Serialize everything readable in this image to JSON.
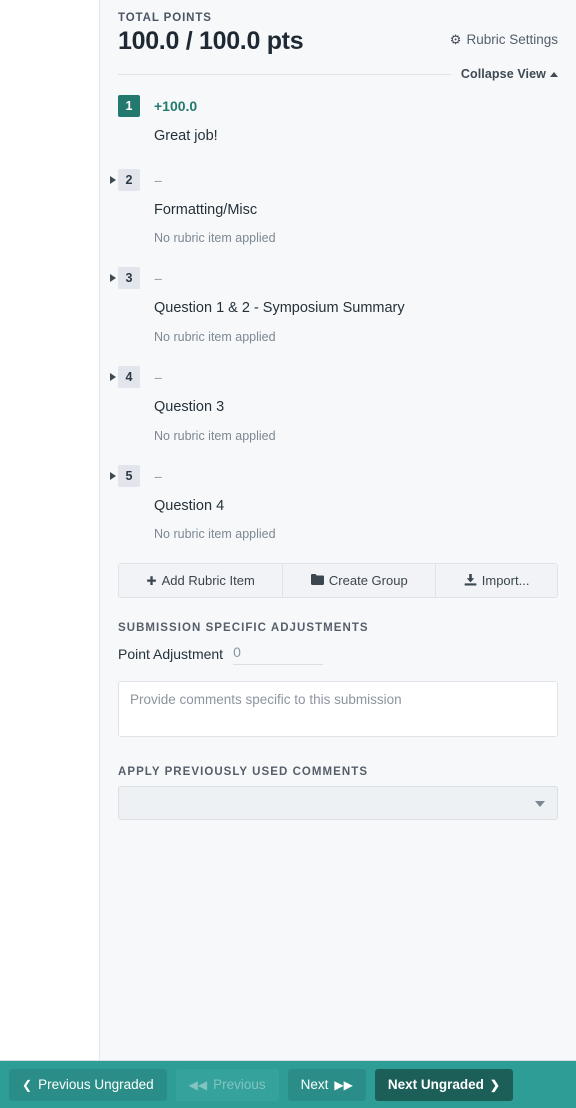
{
  "rubric": {
    "total_points_label": "TOTAL POINTS",
    "total_points_value": "100.0 / 100.0 pts",
    "settings_label": "Rubric Settings",
    "settings_icon": "gear-icon",
    "collapse_label": "Collapse View",
    "collapse_icon": "caret-up-icon",
    "items": [
      {
        "number": "1",
        "points": "+100.0",
        "description": "Great job!",
        "note": "",
        "applied": true,
        "expandable": false
      },
      {
        "number": "2",
        "points": "--",
        "description": "Formatting/Misc",
        "note": "No rubric item applied",
        "applied": false,
        "expandable": true
      },
      {
        "number": "3",
        "points": "--",
        "description": "Question 1 & 2 - Symposium Summary",
        "note": "No rubric item applied",
        "applied": false,
        "expandable": true
      },
      {
        "number": "4",
        "points": "--",
        "description": "Question 3",
        "note": "No rubric item applied",
        "applied": false,
        "expandable": true
      },
      {
        "number": "5",
        "points": "--",
        "description": "Question 4",
        "note": "No rubric item applied",
        "applied": false,
        "expandable": true
      }
    ],
    "actions": [
      {
        "label": "Add Rubric Item",
        "icon": "plus-icon",
        "glyph": "✚"
      },
      {
        "label": "Create Group",
        "icon": "folder-icon",
        "glyph": "📁"
      },
      {
        "label": "Import...",
        "icon": "download-icon",
        "glyph": "⤓"
      }
    ]
  },
  "adjustments": {
    "section_label": "SUBMISSION SPECIFIC ADJUSTMENTS",
    "point_adjustment_label": "Point Adjustment",
    "point_adjustment_value": "0",
    "comment_placeholder": "Provide comments specific to this submission",
    "comment_value": ""
  },
  "previous_comments": {
    "section_label": "APPLY PREVIOUSLY USED COMMENTS",
    "selected_value": "",
    "caret_icon": "caret-down-icon"
  },
  "bottom_nav": {
    "previous_ungraded": {
      "label": "Previous Ungraded",
      "glyph": "❮"
    },
    "previous": {
      "label": "Previous",
      "glyph": "◀◀"
    },
    "next": {
      "label": "Next",
      "glyph": "▶▶"
    },
    "next_ungraded": {
      "label": "Next Ungraded",
      "glyph": "❯"
    }
  },
  "colors": {
    "teal_bar": "#2d9d96",
    "teal_primary": "#1c5f58",
    "badge_applied": "#24796f",
    "panel_bg": "#f7f8fa"
  }
}
